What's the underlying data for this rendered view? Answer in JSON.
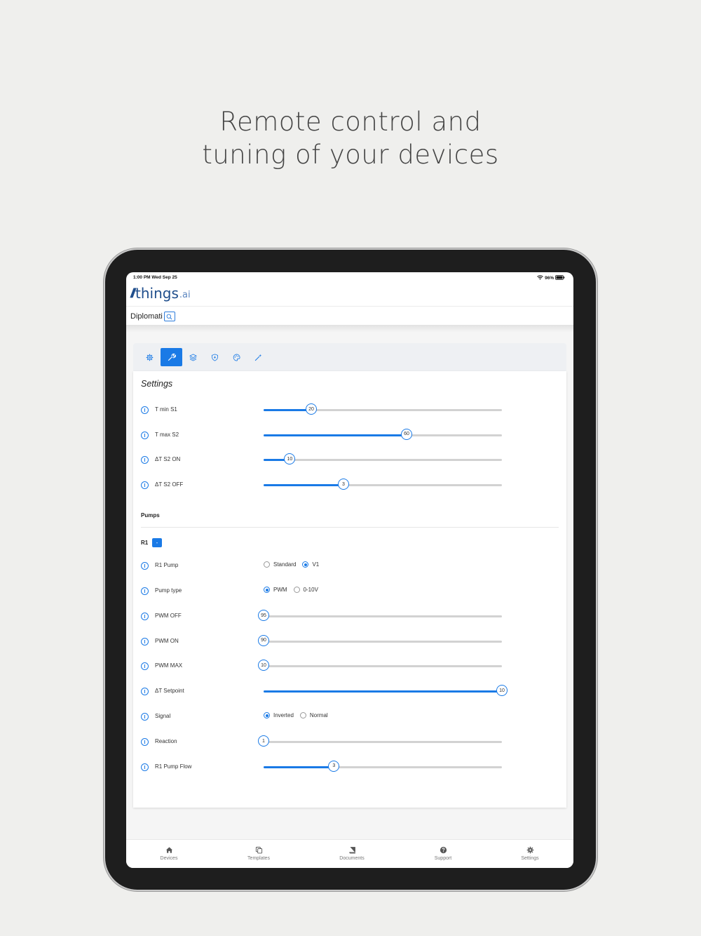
{
  "headline": {
    "line1": "Remote control and",
    "line2": "tuning of your devices"
  },
  "status_bar": {
    "time": "1:00 PM  Wed Sep 25",
    "battery": "96%"
  },
  "brand": {
    "name": "things",
    "suffix": ".ai"
  },
  "device": {
    "name": "Diplomati"
  },
  "tabs": [
    {
      "icon": "gear-icon",
      "active": false
    },
    {
      "icon": "wrench-icon",
      "active": true
    },
    {
      "icon": "layers-icon",
      "active": false
    },
    {
      "icon": "shield-icon",
      "active": false
    },
    {
      "icon": "palette-icon",
      "active": false
    },
    {
      "icon": "magic-wand-icon",
      "active": false
    }
  ],
  "settings": {
    "title": "Settings",
    "sliders": [
      {
        "label": "T min S1",
        "value": "20",
        "fraction": 0.2
      },
      {
        "label": "T max S2",
        "value": "60",
        "fraction": 0.6
      },
      {
        "label": "ΔT S2 ON",
        "value": "10",
        "fraction": 0.11
      },
      {
        "label": "ΔT S2 OFF",
        "value": "3",
        "fraction": 0.335
      }
    ]
  },
  "pumps": {
    "title": "Pumps",
    "r1_label": "R1",
    "r1_button": "-",
    "r1_pump": {
      "label": "R1 Pump",
      "options": [
        "Standard",
        "V1"
      ],
      "selected": "V1"
    },
    "pump_type": {
      "label": "Pump type",
      "options": [
        "PWM",
        "0-10V"
      ],
      "selected": "PWM"
    },
    "sliders_a": [
      {
        "label": "PWM OFF",
        "value": "95",
        "fraction": 0
      },
      {
        "label": "PWM ON",
        "value": "90",
        "fraction": 0
      },
      {
        "label": "PWM MAX",
        "value": "10",
        "fraction": 0
      },
      {
        "label": "ΔT Setpoint",
        "value": "10",
        "fraction": 1
      }
    ],
    "signal": {
      "label": "Signal",
      "options": [
        "Inverted",
        "Normal"
      ],
      "selected": "Inverted"
    },
    "sliders_b": [
      {
        "label": "Reaction",
        "value": "1",
        "fraction": 0
      },
      {
        "label": "R1 Pump Flow",
        "value": "3",
        "fraction": 0.295
      }
    ]
  },
  "nav": [
    {
      "label": "Devices",
      "icon": "home-icon"
    },
    {
      "label": "Templates",
      "icon": "copy-icon"
    },
    {
      "label": "Documents",
      "icon": "book-icon"
    },
    {
      "label": "Support",
      "icon": "help-icon"
    },
    {
      "label": "Settings",
      "icon": "gear-icon"
    }
  ],
  "colors": {
    "accent": "#1a7ae6",
    "brand": "#1f4e8c",
    "background": "#efefed"
  }
}
